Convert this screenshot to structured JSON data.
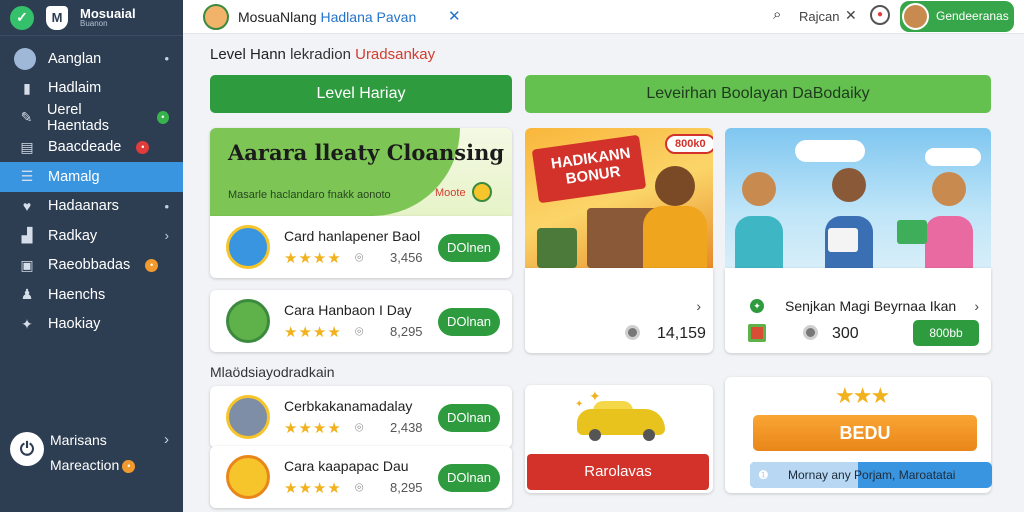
{
  "sidebar": {
    "brand": {
      "name": "Mosuaial",
      "sub": "Buanon"
    },
    "items": [
      {
        "label": "Aanglan",
        "icon": "user-avatar-icon",
        "trail": "•"
      },
      {
        "label": "Hadlaim",
        "icon": "bar-chart-icon",
        "trail": ""
      },
      {
        "label": "Uerel Haentads",
        "icon": "pencil-icon",
        "trail": "",
        "badge": "green"
      },
      {
        "label": "Baacdeade",
        "icon": "document-icon",
        "trail": "",
        "badge": "red"
      },
      {
        "label": "Mamalg",
        "icon": "list-icon",
        "trail": "",
        "active": true
      },
      {
        "label": "Hadaanars",
        "icon": "heart-icon",
        "trail": "•"
      },
      {
        "label": "Radkay",
        "icon": "chart-icon",
        "trail": "›"
      },
      {
        "label": "Raeobbadas",
        "icon": "image-icon",
        "trail": "",
        "badge": "orange"
      },
      {
        "label": "Haenchs",
        "icon": "person-icon",
        "trail": ""
      },
      {
        "label": "Haokiay",
        "icon": "gift-icon",
        "trail": ""
      }
    ],
    "footer": {
      "name": "Marisans",
      "sub": "Mareaction",
      "chev": "›"
    }
  },
  "topbar": {
    "title_part1": "MosuaNlang",
    "title_part2": "Hadlana Pavan",
    "search_label": "Rajcan",
    "user_name": "Gendeeranas"
  },
  "main": {
    "heading": {
      "part1": "Level Hann",
      "part2": "lekradion",
      "part3": "Uradsankay"
    },
    "tab_a": "Level Hariay",
    "tab_b": "Leveirhan Boolayan DaBodaiky",
    "promo": {
      "title": "Aarara lleaty Cloansing",
      "sub": "Masarle haclandaro fnakk aonoto",
      "note": "Moote"
    },
    "offers": [
      {
        "title": "Card hanlapener Baol",
        "count": "3,456",
        "button": "DOlnen",
        "stars": "★★★★"
      },
      {
        "title": "Cara Hanbaon I Day",
        "count": "8,295",
        "button": "DOlnan",
        "stars": "★★★★"
      }
    ],
    "section_label": "Mlaödsiayodradkain",
    "offers2": [
      {
        "title": "Cerbkakanamadalay",
        "count": "2,438",
        "button": "DOlnan",
        "stars": "★★★★"
      },
      {
        "title": "Cara kaapapac Dau",
        "count": "8,295",
        "button": "DOlnan",
        "stars": "★★★★"
      }
    ],
    "hadiah": {
      "banner": "HADIKANN BONUR",
      "pill": "800k0",
      "value": "14,159"
    },
    "kids_stat": {
      "title": "Senjkan Magi Beyrnaa Ikan",
      "value": "300",
      "button": "800bb"
    },
    "car_button": "Rarolavas",
    "bonus": {
      "button": "BEDU",
      "info": "Mornay any Porjam, Maroatatai"
    }
  },
  "colors": {
    "sidebar": "#2d3d52",
    "active": "#3a95e0",
    "green": "#2e9b3f",
    "red": "#d2322a",
    "orange": "#f29a2e"
  }
}
